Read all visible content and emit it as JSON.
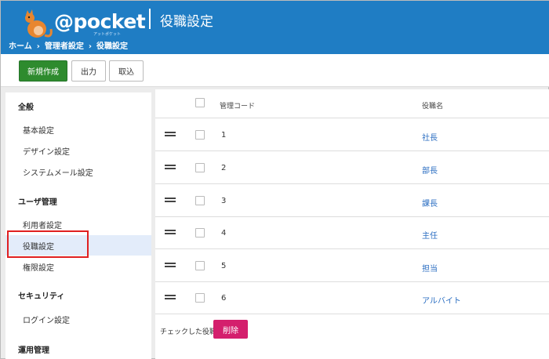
{
  "header": {
    "logo_text": "@pocket",
    "logo_sub": "アットポケット",
    "title": "役職設定"
  },
  "breadcrumb": [
    "ホーム",
    "管理者設定",
    "役職設定"
  ],
  "breadcrumb_sep": "›",
  "toolbar": {
    "new_label": "新規作成",
    "export_label": "出力",
    "import_label": "取込"
  },
  "sidebar": {
    "sections": [
      {
        "heading": "全般",
        "items": [
          "基本設定",
          "デザイン設定",
          "システムメール設定"
        ]
      },
      {
        "heading": "ユーザ管理",
        "items": [
          "利用者設定",
          "役職設定",
          "権限設定"
        ]
      },
      {
        "heading": "セキュリティ",
        "items": [
          "ログイン設定"
        ]
      },
      {
        "heading": "運用管理",
        "items": []
      }
    ],
    "active_item": "役職設定"
  },
  "table": {
    "columns": [
      "管理コード",
      "役職名"
    ],
    "rows": [
      {
        "code": "1",
        "name": "社長"
      },
      {
        "code": "2",
        "name": "部長"
      },
      {
        "code": "3",
        "name": "課長"
      },
      {
        "code": "4",
        "name": "主任"
      },
      {
        "code": "5",
        "name": "担当"
      },
      {
        "code": "6",
        "name": "アルバイト"
      }
    ]
  },
  "footer": {
    "checked_label": "チェックした役職を",
    "delete_label": "削除"
  },
  "colors": {
    "header_bg": "#1f7dc4",
    "new_button": "#2e8b2e",
    "delete_button": "#d41f6d",
    "link": "#2b6ec2",
    "active_bg": "#e3ecfa",
    "highlight": "#e02020"
  }
}
